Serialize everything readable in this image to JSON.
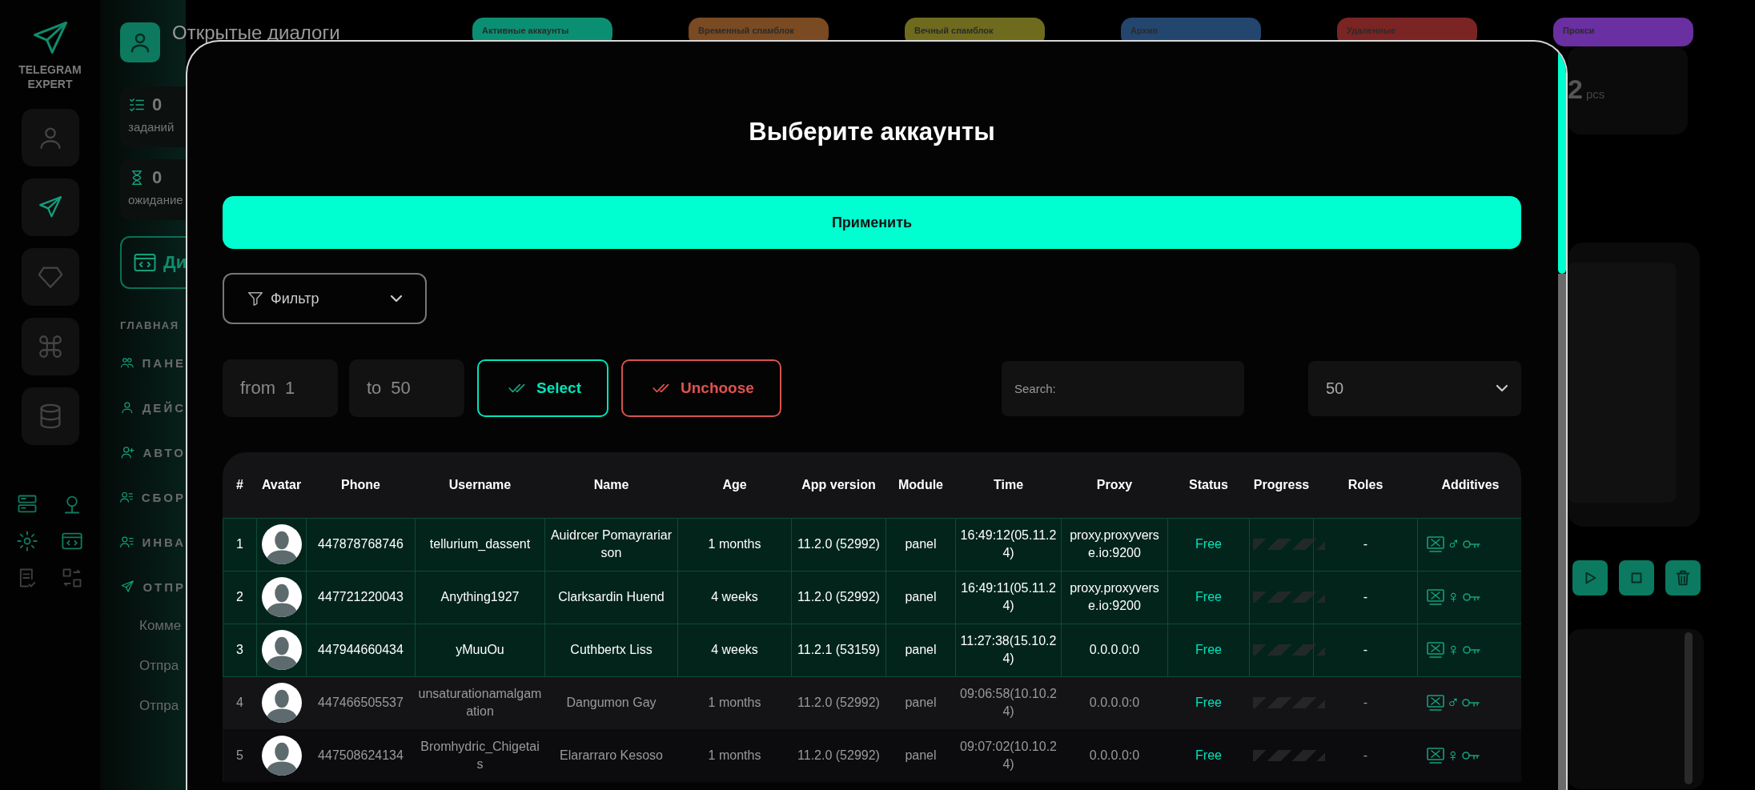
{
  "logo": "TELEGRAM EXPERT",
  "rail": [
    {
      "kind": "user",
      "selected": false
    },
    {
      "kind": "send",
      "selected": true
    },
    {
      "kind": "diamond",
      "selected": false
    },
    {
      "kind": "command",
      "selected": false
    },
    {
      "kind": "database",
      "selected": false
    }
  ],
  "page": {
    "title": "Открытые диалоги"
  },
  "stats": [
    {
      "kind": "tasks",
      "value": "0",
      "label": "заданий"
    },
    {
      "kind": "hourglass",
      "value": "0",
      "label": "ожидание"
    }
  ],
  "dialogs_button": "Ди",
  "menu": {
    "heading": "ГЛАВНАЯ",
    "items": [
      {
        "kind": "people",
        "label": "ПАНЕ"
      },
      {
        "kind": "user",
        "label": "ДЕЙС"
      },
      {
        "kind": "user-plus",
        "label": "АВТО"
      },
      {
        "kind": "user-list",
        "label": "СБОР"
      },
      {
        "kind": "user-list",
        "label": "ИНВА"
      },
      {
        "kind": "send",
        "label": "ОТПР",
        "children": [
          {
            "label": "Комме"
          },
          {
            "label": "Отпра"
          },
          {
            "label": "Отпра"
          }
        ]
      }
    ]
  },
  "category_tabs": [
    {
      "label": "Активные аккаунты",
      "color": "#0b8f72"
    },
    {
      "label": "Временный спамблок",
      "color": "#7a4a22"
    },
    {
      "label": "Вечный спамблок",
      "color": "#6e6b1e"
    },
    {
      "label": "Архив",
      "color": "#23466f"
    },
    {
      "label": "Удаленные",
      "color": "#7a2424"
    },
    {
      "label": "Прокси",
      "color": "#6a2fa0"
    }
  ],
  "summary": {
    "value": "2",
    "unit": "pcs"
  },
  "modal": {
    "title": "Выберите аккаунты",
    "apply_button": "Применить",
    "filter": "Фильтр",
    "range": {
      "from_label": "from",
      "from_value": "1",
      "to_label": "to",
      "to_value": "50"
    },
    "select_button": "Select",
    "unchoose_button": "Unchoose",
    "search": {
      "placeholder": "Search:"
    },
    "page_size": "50",
    "table": {
      "columns": [
        "#",
        "Avatar",
        "Phone",
        "Username",
        "Name",
        "Age",
        "App version",
        "Module",
        "Time",
        "Proxy",
        "Status",
        "Progress",
        "Roles",
        "Additives"
      ],
      "rows": [
        {
          "selected": true,
          "number": "1",
          "phone": "447878768746",
          "username": "tellurium_dassent",
          "name": "Auidrcer Pomayrariarson",
          "age": "1 months",
          "app_version": "11.2.0 (52992)",
          "module": "panel",
          "time": "16:49:12(05.11.24)",
          "proxy": "proxy.proxyverse.io:9200",
          "status": "Free",
          "roles": "-",
          "sex": "♂"
        },
        {
          "selected": true,
          "number": "2",
          "phone": "447721220043",
          "username": "Anything1927",
          "name": "Clarksardin Huend",
          "age": "4 weeks",
          "app_version": "11.2.0 (52992)",
          "module": "panel",
          "time": "16:49:11(05.11.24)",
          "proxy": "proxy.proxyverse.io:9200",
          "status": "Free",
          "roles": "-",
          "sex": "♀"
        },
        {
          "selected": true,
          "number": "3",
          "phone": "447944660434",
          "username": "yMuuOu",
          "name": "Cuthbertx Liss",
          "age": "4 weeks",
          "app_version": "11.2.1 (53159)",
          "module": "panel",
          "time": "11:27:38(15.10.24)",
          "proxy": "0.0.0.0:0",
          "status": "Free",
          "roles": "-",
          "sex": "♀"
        },
        {
          "selected": false,
          "number": "4",
          "phone": "447466505537",
          "username": "unsaturationamalgamation",
          "name": "Dangumon Gay",
          "age": "1 months",
          "app_version": "11.2.0 (52992)",
          "module": "panel",
          "time": "09:06:58(10.10.24)",
          "proxy": "0.0.0.0:0",
          "status": "Free",
          "roles": "-",
          "sex": "♂"
        },
        {
          "selected": false,
          "number": "5",
          "phone": "447508624134",
          "username": "Bromhydric_Chigetais",
          "name": "Elararraro Kesoso",
          "age": "1 months",
          "app_version": "11.2.0 (52992)",
          "module": "panel",
          "time": "09:07:02(10.10.24)",
          "proxy": "0.0.0.0:0",
          "status": "Free",
          "roles": "-",
          "sex": "♀"
        }
      ]
    }
  }
}
